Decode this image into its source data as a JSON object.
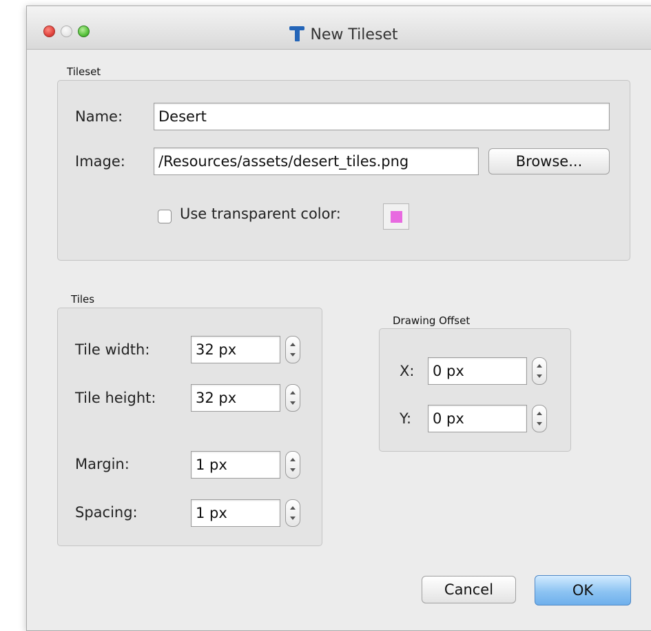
{
  "window": {
    "title": "New Tileset"
  },
  "tileset": {
    "group_label": "Tileset",
    "name_label": "Name:",
    "name_value": "Desert",
    "image_label": "Image:",
    "image_value": "/Resources/assets/desert_tiles.png",
    "browse_label": "Browse...",
    "transparent_label": "Use transparent color:",
    "transparent_checked": false,
    "transparent_color": "#e86ae0"
  },
  "tiles": {
    "group_label": "Tiles",
    "tile_width_label": "Tile width:",
    "tile_width_value": "32 px",
    "tile_height_label": "Tile height:",
    "tile_height_value": "32 px",
    "margin_label": "Margin:",
    "margin_value": "1 px",
    "spacing_label": "Spacing:",
    "spacing_value": "1 px"
  },
  "offset": {
    "group_label": "Drawing Offset",
    "x_label": "X:",
    "x_value": "0 px",
    "y_label": "Y:",
    "y_value": "0 px"
  },
  "buttons": {
    "cancel_label": "Cancel",
    "ok_label": "OK"
  },
  "icons": {
    "title": "tiled-logo-icon",
    "close": "close-window-icon",
    "minimize": "minimize-window-icon",
    "zoom": "zoom-window-icon",
    "stepper_up": "chevron-up-icon",
    "stepper_down": "chevron-down-icon"
  }
}
